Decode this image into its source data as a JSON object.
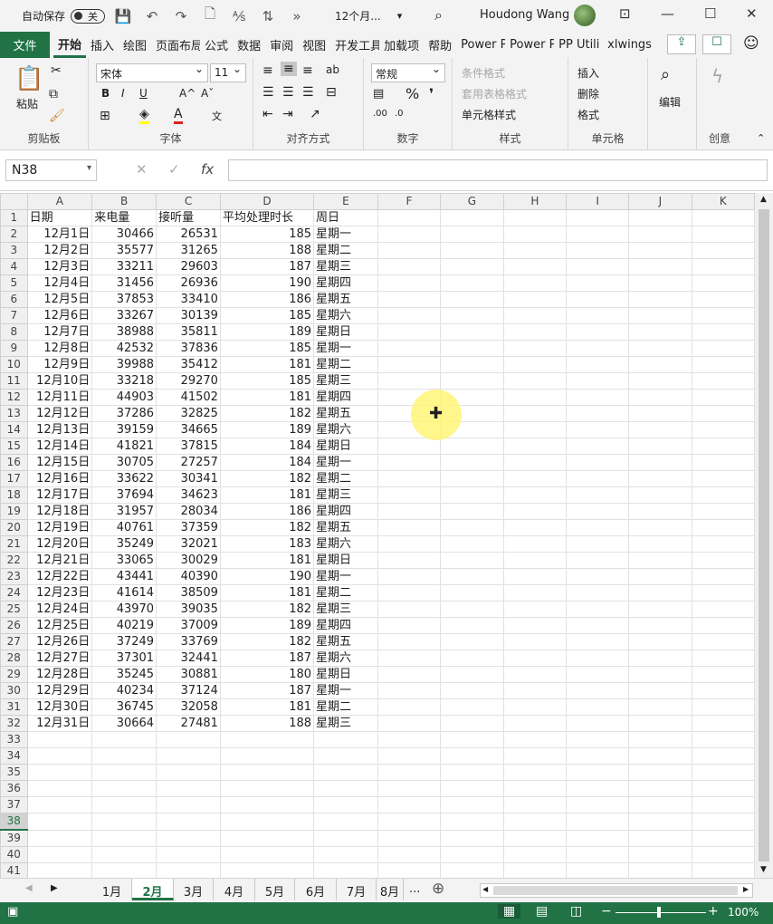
{
  "titlebar": {
    "autosave_label": "自动保存",
    "autosave_state": "关",
    "doc_title": "12个月...",
    "more_label": "»",
    "user_name": "Houdong Wang",
    "min_glyph": "—",
    "max_glyph": "☐",
    "close_glyph": "✕"
  },
  "tabs": {
    "file": "文件",
    "items": [
      "开始",
      "插入",
      "绘图",
      "页面布局",
      "公式",
      "数据",
      "审阅",
      "视图",
      "开发工具",
      "加载项",
      "帮助",
      "Power P",
      "Power P",
      "PP Utili",
      "xlwings"
    ]
  },
  "ribbon": {
    "clipboard": {
      "paste": "粘贴",
      "label": "剪贴板"
    },
    "font": {
      "name": "宋体",
      "size": "11",
      "bold": "B",
      "italic": "I",
      "underline": "U",
      "grow": "A^",
      "shrink": "Aˇ",
      "label": "字体"
    },
    "alignment": {
      "label": "对齐方式"
    },
    "number": {
      "format": "常规",
      "percent": "%",
      "comma": "❜",
      "label": "数字"
    },
    "styles": {
      "conditional": "条件格式",
      "table": "套用表格格式",
      "cell": "单元格样式",
      "label": "样式"
    },
    "cells": {
      "insert": "插入",
      "delete": "删除",
      "format": "格式",
      "label": "单元格"
    },
    "editing": {
      "label": "编辑"
    },
    "creative": {
      "label": "创意"
    }
  },
  "formula_bar": {
    "name_box": "N38",
    "fx": "fx",
    "cancel": "✕",
    "enter": "✓",
    "value": ""
  },
  "grid": {
    "columns": [
      "A",
      "B",
      "C",
      "D",
      "E",
      "F",
      "G",
      "H",
      "I",
      "J",
      "K"
    ],
    "header_row": [
      "日期",
      "来电量",
      "接听量",
      "平均处理时长",
      "周日"
    ],
    "rows": [
      [
        "12月1日",
        "30466",
        "26531",
        "185",
        "星期一"
      ],
      [
        "12月2日",
        "35577",
        "31265",
        "188",
        "星期二"
      ],
      [
        "12月3日",
        "33211",
        "29603",
        "187",
        "星期三"
      ],
      [
        "12月4日",
        "31456",
        "26936",
        "190",
        "星期四"
      ],
      [
        "12月5日",
        "37853",
        "33410",
        "186",
        "星期五"
      ],
      [
        "12月6日",
        "33267",
        "30139",
        "185",
        "星期六"
      ],
      [
        "12月7日",
        "38988",
        "35811",
        "189",
        "星期日"
      ],
      [
        "12月8日",
        "42532",
        "37836",
        "185",
        "星期一"
      ],
      [
        "12月9日",
        "39988",
        "35412",
        "181",
        "星期二"
      ],
      [
        "12月10日",
        "33218",
        "29270",
        "185",
        "星期三"
      ],
      [
        "12月11日",
        "44903",
        "41502",
        "181",
        "星期四"
      ],
      [
        "12月12日",
        "37286",
        "32825",
        "182",
        "星期五"
      ],
      [
        "12月13日",
        "39159",
        "34665",
        "189",
        "星期六"
      ],
      [
        "12月14日",
        "41821",
        "37815",
        "184",
        "星期日"
      ],
      [
        "12月15日",
        "30705",
        "27257",
        "184",
        "星期一"
      ],
      [
        "12月16日",
        "33622",
        "30341",
        "182",
        "星期二"
      ],
      [
        "12月17日",
        "37694",
        "34623",
        "181",
        "星期三"
      ],
      [
        "12月18日",
        "31957",
        "28034",
        "186",
        "星期四"
      ],
      [
        "12月19日",
        "40761",
        "37359",
        "182",
        "星期五"
      ],
      [
        "12月20日",
        "35249",
        "32021",
        "183",
        "星期六"
      ],
      [
        "12月21日",
        "33065",
        "30029",
        "181",
        "星期日"
      ],
      [
        "12月22日",
        "43441",
        "40390",
        "190",
        "星期一"
      ],
      [
        "12月23日",
        "41614",
        "38509",
        "181",
        "星期二"
      ],
      [
        "12月24日",
        "43970",
        "39035",
        "182",
        "星期三"
      ],
      [
        "12月25日",
        "40219",
        "37009",
        "189",
        "星期四"
      ],
      [
        "12月26日",
        "37249",
        "33769",
        "182",
        "星期五"
      ],
      [
        "12月27日",
        "37301",
        "32441",
        "187",
        "星期六"
      ],
      [
        "12月28日",
        "35245",
        "30881",
        "180",
        "星期日"
      ],
      [
        "12月29日",
        "40234",
        "37124",
        "187",
        "星期一"
      ],
      [
        "12月30日",
        "36745",
        "32058",
        "181",
        "星期二"
      ],
      [
        "12月31日",
        "30664",
        "27481",
        "188",
        "星期三"
      ]
    ],
    "total_rows": 41,
    "selected_row": 38
  },
  "sheets": {
    "tabs": [
      "1月",
      "2月",
      "3月",
      "4月",
      "5月",
      "6月",
      "7月",
      "8月"
    ],
    "active_index": 1,
    "more": "...",
    "add": "⊕"
  },
  "status": {
    "zoom": "100%"
  },
  "colors": {
    "accent": "#217346"
  }
}
